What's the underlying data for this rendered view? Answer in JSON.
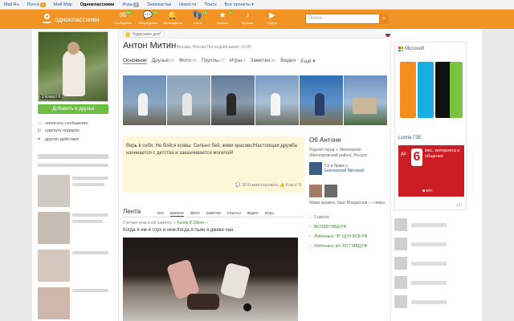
{
  "mailbar": {
    "links": [
      "Mail.Ru",
      "Почта",
      "Мой Мир",
      "Одноклассники",
      "Игры",
      "Знакомства",
      "Новости",
      "Поиск",
      "Все проекты ▾"
    ],
    "mail_count": "1",
    "games_count": "1"
  },
  "topbar": {
    "logo_text": "одноклассники",
    "nav": [
      {
        "label": "Сообщения",
        "icon": "envelope-icon",
        "glyph": "✉",
        "badge": "99+"
      },
      {
        "label": "Обсуждения",
        "icon": "chat-icon",
        "glyph": "💬",
        "badge": "29"
      },
      {
        "label": "Оповещения",
        "icon": "bell-icon",
        "glyph": "🔔",
        "badge": ""
      },
      {
        "label": "Гости",
        "icon": "footprints-icon",
        "glyph": "👣",
        "badge": "12"
      },
      {
        "label": "Оценки",
        "icon": "star-icon",
        "glyph": "★",
        "badge": "5"
      },
      {
        "label": "Музыка",
        "icon": "music-icon",
        "glyph": "♪",
        "badge": ""
      },
      {
        "label": "Видео",
        "icon": "video-icon",
        "glyph": "▶",
        "badge": ""
      }
    ],
    "search_placeholder": "Поиск"
  },
  "left": {
    "avatar_stats": "2  Класс! 6",
    "add_friend": "Добавить в друзья",
    "actions": [
      {
        "label": "написать сообщение",
        "icon": "message-icon",
        "glyph": "▭"
      },
      {
        "label": "сделать подарок",
        "icon": "gift-icon",
        "glyph": "◘"
      },
      {
        "label": "другие действия",
        "icon": "dropdown-icon",
        "glyph": "▾"
      }
    ]
  },
  "profile": {
    "holiday": "Чудесного дня!",
    "name": "Антон Митин",
    "subinfo": "Москва, Россия  Последний визит: 02:05",
    "tabs": [
      {
        "label": "Основное",
        "count": ""
      },
      {
        "label": "Друзья",
        "count": "83"
      },
      {
        "label": "Фото",
        "count": "56"
      },
      {
        "label": "Группы",
        "count": "27"
      },
      {
        "label": "Игры",
        "count": "8"
      },
      {
        "label": "Заметки",
        "count": "36"
      },
      {
        "label": "Видео",
        "count": ""
      },
      {
        "label": "Ещё ▾",
        "count": ""
      }
    ],
    "quote": "Верь в себя. Не бойся ксивы. Сильно бей, живи красиво!Настоящая дружба начинается с детства и заканчивается могилой!",
    "quote_footer": "💬 39 Комментировать    👍 Класс! 8"
  },
  "about": {
    "title": "Об Антоне",
    "hometown": "Родной город: г. Миллерово (Миллеровский район), Россия",
    "marriage_prefix": "Со в браке с",
    "marriage_name": "Екатериной Митиной",
    "family_text": "Мама марина, брат Владислав — семья",
    "jobs": [
      {
        "icon": "school-icon",
        "text": "1 школа"
      },
      {
        "icon": "work-icon",
        "text": "МСОШН МВД РФ"
      },
      {
        "icon": "work-icon",
        "text": "Лейтенант, \"В\" ЦСН ФСБ РФ"
      },
      {
        "icon": "work-icon",
        "text": "Лейтенант, в/ч 3377 МВД РФ"
      }
    ]
  },
  "feed": {
    "title": "Лента",
    "tabs": [
      "все",
      "важное",
      "фото",
      "заметки",
      "классы",
      "видео",
      "игры"
    ],
    "note_meta": "Считает классной заметку",
    "note_author": "✓Тында 8 10ёлл ✓",
    "note_text": "Когда  я ем-я глух и нем.Когда  я пьян я джеки чан."
  },
  "ads": {
    "brand": "Microsoft",
    "model": "Lumia 735",
    "mts_do": "до",
    "mts_num": "6",
    "mts_text": "мес. интернета и общения",
    "mts_logo": "■ мтс",
    "age": "12+"
  },
  "colors": {
    "orange": "#f29325",
    "green": "#6fbe44",
    "mts_red": "#cc1c24"
  }
}
